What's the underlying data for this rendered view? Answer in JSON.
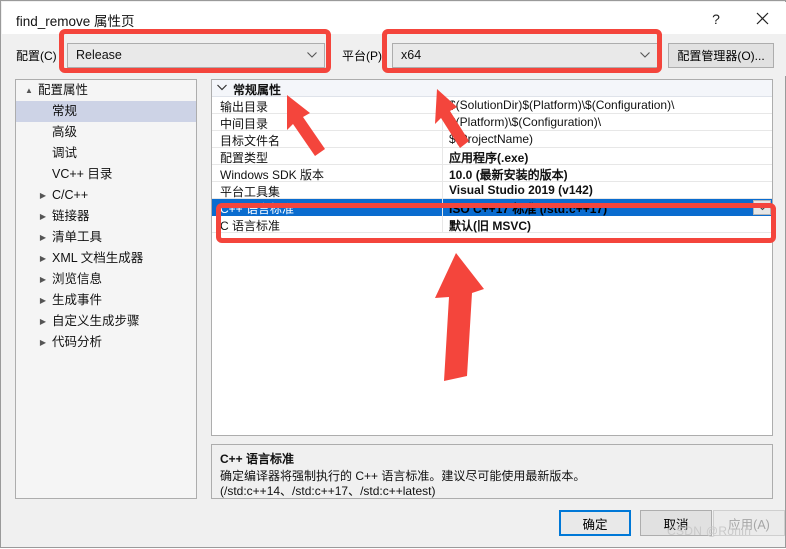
{
  "window": {
    "title": "find_remove 属性页",
    "help_label": "?",
    "close_label": "close-icon"
  },
  "config_bar": {
    "config_label": "配置(C)",
    "config_value": "Release",
    "platform_label": "平台(P)",
    "platform_value": "x64",
    "config_manager_label": "配置管理器(O)..."
  },
  "tree": {
    "root": {
      "label": "配置属性",
      "glyph": "▲"
    },
    "items": [
      {
        "label": "常规",
        "expandable": false,
        "selected": true
      },
      {
        "label": "高级",
        "expandable": false,
        "selected": false
      },
      {
        "label": "调试",
        "expandable": false,
        "selected": false
      },
      {
        "label": "VC++ 目录",
        "expandable": false,
        "selected": false
      },
      {
        "label": "C/C++",
        "expandable": true,
        "selected": false
      },
      {
        "label": "链接器",
        "expandable": true,
        "selected": false
      },
      {
        "label": "清单工具",
        "expandable": true,
        "selected": false
      },
      {
        "label": "XML 文档生成器",
        "expandable": true,
        "selected": false
      },
      {
        "label": "浏览信息",
        "expandable": true,
        "selected": false
      },
      {
        "label": "生成事件",
        "expandable": true,
        "selected": false
      },
      {
        "label": "自定义生成步骤",
        "expandable": true,
        "selected": false
      },
      {
        "label": "代码分析",
        "expandable": true,
        "selected": false
      }
    ]
  },
  "grid": {
    "section_header": "常规属性",
    "rows": [
      {
        "name": "输出目录",
        "value": "$(SolutionDir)$(Platform)\\$(Configuration)\\",
        "bold": false,
        "selected": false
      },
      {
        "name": "中间目录",
        "value": "$(Platform)\\$(Configuration)\\",
        "bold": false,
        "selected": false
      },
      {
        "name": "目标文件名",
        "value": "$(ProjectName)",
        "bold": false,
        "selected": false
      },
      {
        "name": "配置类型",
        "value": "应用程序(.exe)",
        "bold": true,
        "selected": false
      },
      {
        "name": "Windows SDK 版本",
        "value": "10.0 (最新安装的版本)",
        "bold": true,
        "selected": false
      },
      {
        "name": "平台工具集",
        "value": "Visual Studio 2019 (v142)",
        "bold": true,
        "selected": false
      },
      {
        "name": "C++ 语言标准",
        "value": "ISO C++17 标准 (/std:c++17)",
        "bold": true,
        "selected": true
      },
      {
        "name": "C 语言标准",
        "value": "默认(旧 MSVC)",
        "bold": true,
        "selected": false
      }
    ]
  },
  "description": {
    "title": "C++ 语言标准",
    "body": "确定编译器将强制执行的 C++ 语言标准。建议尽可能使用最新版本。(/std:c++14、/std:c++17、/std:c++latest)"
  },
  "footer": {
    "ok_label": "确定",
    "cancel_label": "取消",
    "apply_label": "应用(A)",
    "watermark": "CSDN @Ronin"
  },
  "annotations": {
    "highlight_color": "#f4453c",
    "boxes": [
      "config-combo",
      "platform-combo",
      "cpp-standard-row"
    ],
    "arrows": 3
  }
}
